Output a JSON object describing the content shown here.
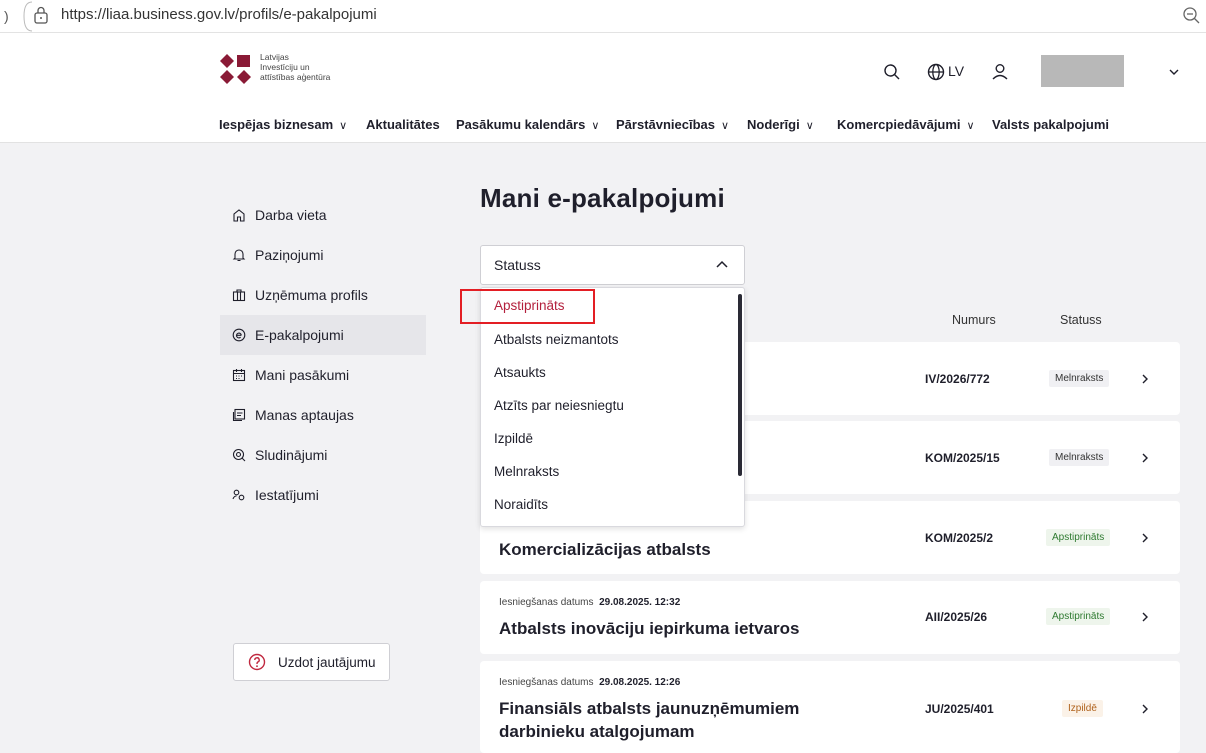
{
  "browser": {
    "url": "https://liaa.business.gov.lv/profils/e-pakalpojumi"
  },
  "header": {
    "logo_lines": [
      "Latvijas",
      "Investīciju un",
      "attīstības aģentūra"
    ],
    "language": "LV",
    "brand_color": "#8a1a36"
  },
  "nav": {
    "items": [
      {
        "label": "Iespējas biznesam",
        "has_dropdown": true
      },
      {
        "label": "Aktualitātes",
        "has_dropdown": false
      },
      {
        "label": "Pasākumu kalendārs",
        "has_dropdown": true
      },
      {
        "label": "Pārstāvniecības",
        "has_dropdown": true
      },
      {
        "label": "Noderīgi",
        "has_dropdown": true
      },
      {
        "label": "Komercpiedāvājumi",
        "has_dropdown": true
      },
      {
        "label": "Valsts pakalpojumi",
        "has_dropdown": false
      }
    ],
    "chevron": "∨"
  },
  "sidebar": {
    "items": [
      {
        "label": "Darba vieta",
        "icon": "home-icon"
      },
      {
        "label": "Paziņojumi",
        "icon": "bell-icon"
      },
      {
        "label": "Uzņēmuma profils",
        "icon": "briefcase-icon"
      },
      {
        "label": "E-pakalpojumi",
        "icon": "e-service-icon",
        "active": true
      },
      {
        "label": "Mani pasākumi",
        "icon": "calendar-icon"
      },
      {
        "label": "Manas aptaujas",
        "icon": "survey-icon"
      },
      {
        "label": "Sludinājumi",
        "icon": "announcement-icon"
      },
      {
        "label": "Iestatījumi",
        "icon": "settings-icon"
      }
    ],
    "ask_button": "Uzdot jautājumu"
  },
  "main": {
    "title": "Mani e-pakalpojumi",
    "status_select": {
      "label": "Statuss",
      "options": [
        "Apstiprināts",
        "Atbalsts neizmantots",
        "Atsaukts",
        "Atzīts par neiesniegtu",
        "Izpildē",
        "Melnraksts",
        "Noraidīts"
      ],
      "highlighted": "Apstiprināts"
    },
    "columns": {
      "number": "Numurs",
      "status": "Statuss"
    },
    "cards": [
      {
        "meta_label": "",
        "meta_date": "",
        "title": "",
        "number": "IV/2026/772",
        "status": "Melnraksts",
        "status_kind": "draft"
      },
      {
        "meta_label": "",
        "meta_date": "",
        "title": "",
        "number": "KOM/2025/15",
        "status": "Melnraksts",
        "status_kind": "draft"
      },
      {
        "meta_label": "",
        "meta_date": "",
        "title": "Komercializācijas atbalsts",
        "number": "KOM/2025/2",
        "status": "Apstiprināts",
        "status_kind": "ok"
      },
      {
        "meta_label": "Iesniegšanas datums",
        "meta_date": "29.08.2025. 12:32",
        "title": "Atbalsts inovāciju iepirkuma ietvaros",
        "number": "AII/2025/26",
        "status": "Apstiprināts",
        "status_kind": "ok"
      },
      {
        "meta_label": "Iesniegšanas datums",
        "meta_date": "29.08.2025. 12:26",
        "title": "Finansiāls atbalsts jaunuzņēmumiem darbinieku atalgojumam",
        "number": "JU/2025/401",
        "status": "Izpildē",
        "status_kind": "wip"
      }
    ]
  }
}
